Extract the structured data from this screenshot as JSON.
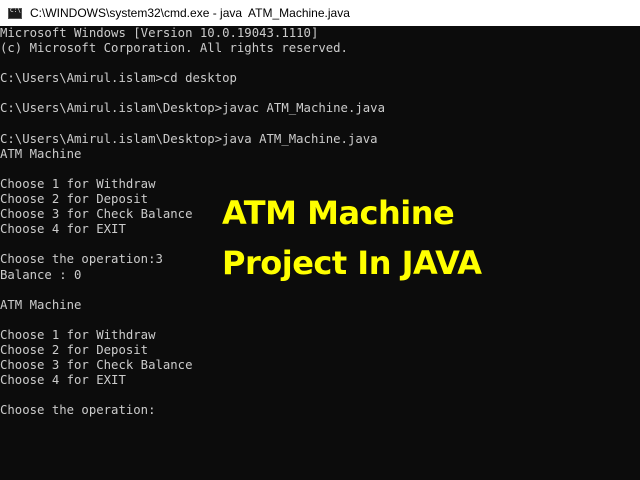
{
  "window": {
    "title": "C:\\WINDOWS\\system32\\cmd.exe - java  ATM_Machine.java"
  },
  "console": {
    "lines": [
      "Microsoft Windows [Version 10.0.19043.1110]",
      "(c) Microsoft Corporation. All rights reserved.",
      "",
      "C:\\Users\\Amirul.islam>cd desktop",
      "",
      "C:\\Users\\Amirul.islam\\Desktop>javac ATM_Machine.java",
      "",
      "C:\\Users\\Amirul.islam\\Desktop>java ATM_Machine.java",
      "ATM Machine",
      "",
      "Choose 1 for Withdraw",
      "Choose 2 for Deposit",
      "Choose 3 for Check Balance",
      "Choose 4 for EXIT",
      "",
      "Choose the operation:3",
      "Balance : 0",
      "",
      "ATM Machine",
      "",
      "Choose 1 for Withdraw",
      "Choose 2 for Deposit",
      "Choose 3 for Check Balance",
      "Choose 4 for EXIT",
      "",
      "Choose the operation:"
    ]
  },
  "overlay": {
    "line1": "ATM Machine",
    "line2": "Project In JAVA"
  },
  "colors": {
    "console_bg": "#0c0c0c",
    "console_text": "#cccccc",
    "overlay_text": "#ffff00",
    "titlebar_bg": "#ffffff"
  },
  "icons": {
    "app": "cmd-icon"
  }
}
